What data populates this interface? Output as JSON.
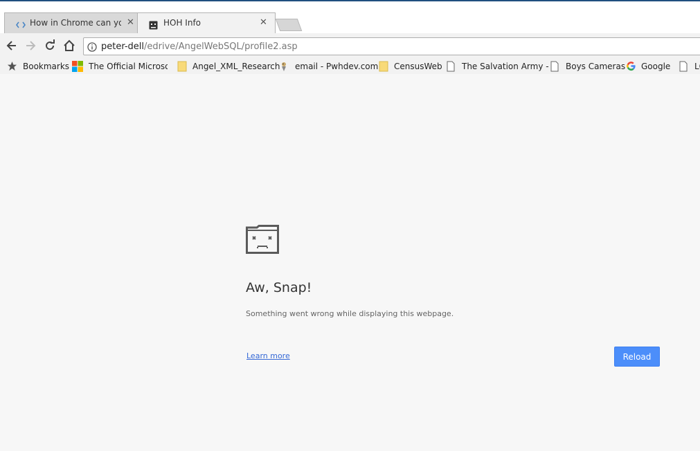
{
  "tabs": [
    {
      "title": "How in Chrome can you",
      "icon": "code-icon",
      "active": false
    },
    {
      "title": "HOH Info",
      "icon": "sad-page-icon",
      "active": true
    }
  ],
  "toolbar": {
    "url_host": "peter-dell",
    "url_path": "/edrive/AngelWebSQL/profile2.asp"
  },
  "bookmarks": [
    {
      "label": "Bookmarks",
      "icon": "star-icon"
    },
    {
      "label": "The Official Microsoft",
      "icon": "microsoft-logo-icon"
    },
    {
      "label": "Angel_XML_Research",
      "icon": "folder-icon"
    },
    {
      "label": "email - Pwhdev.com",
      "icon": "bird-icon"
    },
    {
      "label": "CensusWeb",
      "icon": "folder-icon"
    },
    {
      "label": "The Salvation Army -",
      "icon": "page-icon"
    },
    {
      "label": "Boys Cameras",
      "icon": "page-icon"
    },
    {
      "label": "Google",
      "icon": "google-icon"
    },
    {
      "label": "LC",
      "icon": "page-icon"
    }
  ],
  "error": {
    "heading": "Aw, Snap!",
    "message": "Something went wrong while displaying this webpage.",
    "learn_more": "Learn more",
    "reload": "Reload"
  },
  "colors": {
    "accent": "#4c8efa",
    "link": "#3367d6",
    "background": "#f7f7f7"
  }
}
